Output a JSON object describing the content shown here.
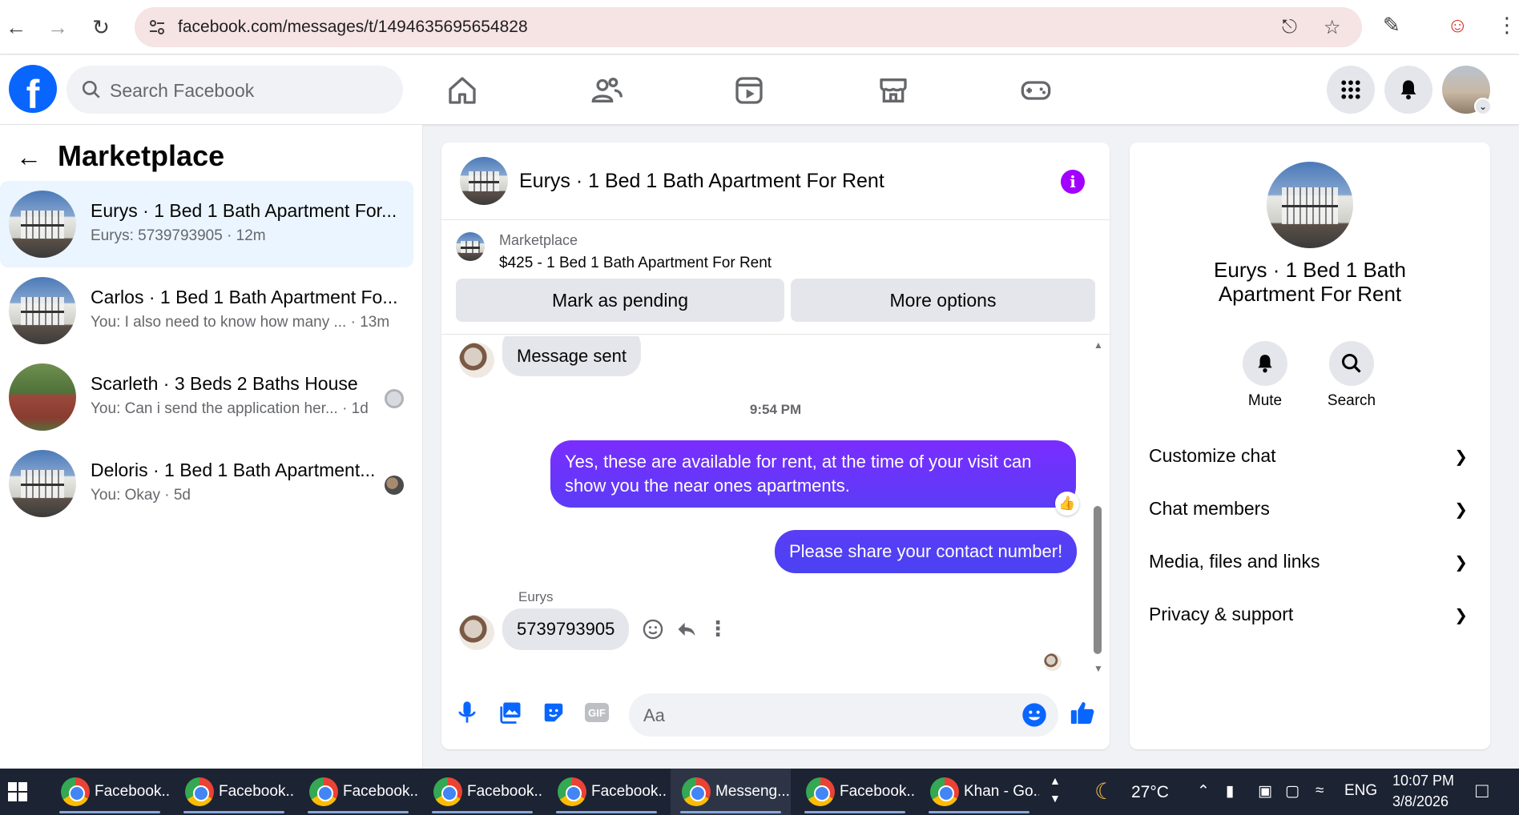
{
  "browser": {
    "url": "facebook.com/messages/t/1494635695654828"
  },
  "fb": {
    "search_placeholder": "Search Facebook"
  },
  "sidebar": {
    "title": "Marketplace",
    "conversations": [
      {
        "name": "Eurys · 1 Bed 1 Bath Apartment For...",
        "snippet": "Eurys: 5739793905 · 12m"
      },
      {
        "name": "Carlos · 1 Bed 1 Bath Apartment Fo...",
        "snippet": "You: I also need to know how many ... · 13m"
      },
      {
        "name": "Scarleth · 3 Beds 2 Baths House",
        "snippet": "You: Can i send the application her... · 1d"
      },
      {
        "name": "Deloris · 1 Bed 1 Bath Apartment...",
        "snippet": "You: Okay · 5d"
      }
    ]
  },
  "chat": {
    "title": "Eurys · 1 Bed 1 Bath Apartment For Rent",
    "listing_label": "Marketplace",
    "listing_price": "$425 - 1 Bed 1 Bath Apartment For Rent",
    "mark_pending": "Mark as pending",
    "more_options": "More options",
    "messages": {
      "m1": "Message sent",
      "time": "9:54 PM",
      "m2": "Yes, these are available for rent, at the time of your visit can show you the near ones apartments.",
      "m3": "Please share your contact number!",
      "sender": "Eurys",
      "m4": "5739793905"
    },
    "composer_placeholder": "Aa"
  },
  "panel": {
    "name": "Eurys · 1 Bed 1 Bath Apartment For Rent",
    "mute": "Mute",
    "search": "Search",
    "sections": [
      "Customize chat",
      "Chat members",
      "Media, files and links",
      "Privacy & support"
    ]
  },
  "taskbar": {
    "items": [
      "Facebook...",
      "Facebook...",
      "Facebook...",
      "Facebook...",
      "Facebook...",
      "Messeng...",
      "Facebook...",
      "Khan - Go..."
    ],
    "weather": "27°C",
    "lang": "ENG",
    "time": "10:07 PM",
    "date": "3/8/2026"
  },
  "colors": {
    "fb_blue": "#0866ff",
    "bubble_purple": "#6a32f8",
    "info_purple": "#a100ff"
  }
}
